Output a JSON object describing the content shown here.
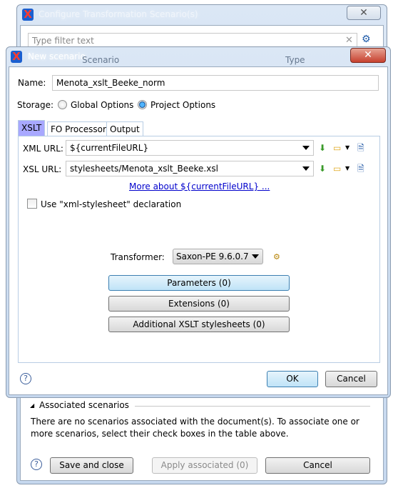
{
  "back_window": {
    "title": "Configure Transformation Scenario(s)",
    "filter_placeholder": "Type filter text",
    "columns": [
      "Scenario",
      "Type"
    ],
    "associated_label": "Associated scenarios",
    "associated_text_1": "There are no scenarios associated with the document(s). To associate one or",
    "associated_text_2": "more scenarios, select their check boxes in the table above.",
    "save_close": "Save and close",
    "apply_associated": "Apply associated (0)",
    "cancel": "Cancel"
  },
  "dialog": {
    "title": "New scenario",
    "name_label": "Name:",
    "name_value": "Menota_xslt_Beeke_norm",
    "storage_label": "Storage:",
    "storage_options": [
      "Global Options",
      "Project Options"
    ],
    "storage_selected": "Project Options",
    "tabs": [
      "XSLT",
      "FO Processor",
      "Output"
    ],
    "active_tab": "XSLT",
    "xml_url_label": "XML URL:",
    "xml_url_value": "${currentFileURL}",
    "xsl_url_label": "XSL URL:",
    "xsl_url_value": "stylesheets/Menota_xslt_Beeke.xsl",
    "more_link": "More about ${currentFileURL} ...",
    "xml_stylesheet_checkbox": "Use \"xml-stylesheet\" declaration",
    "xml_stylesheet_checked": false,
    "transformer_label": "Transformer:",
    "transformer_value": "Saxon-PE 9.6.0.7",
    "parameters": "Parameters (0)",
    "extensions": "Extensions (0)",
    "additional": "Additional XSLT stylesheets (0)",
    "ok": "OK",
    "cancel": "Cancel"
  },
  "colors": {
    "active_tab": "#a8a8ff",
    "link": "#0000cc",
    "close_red": "#c7412f"
  }
}
